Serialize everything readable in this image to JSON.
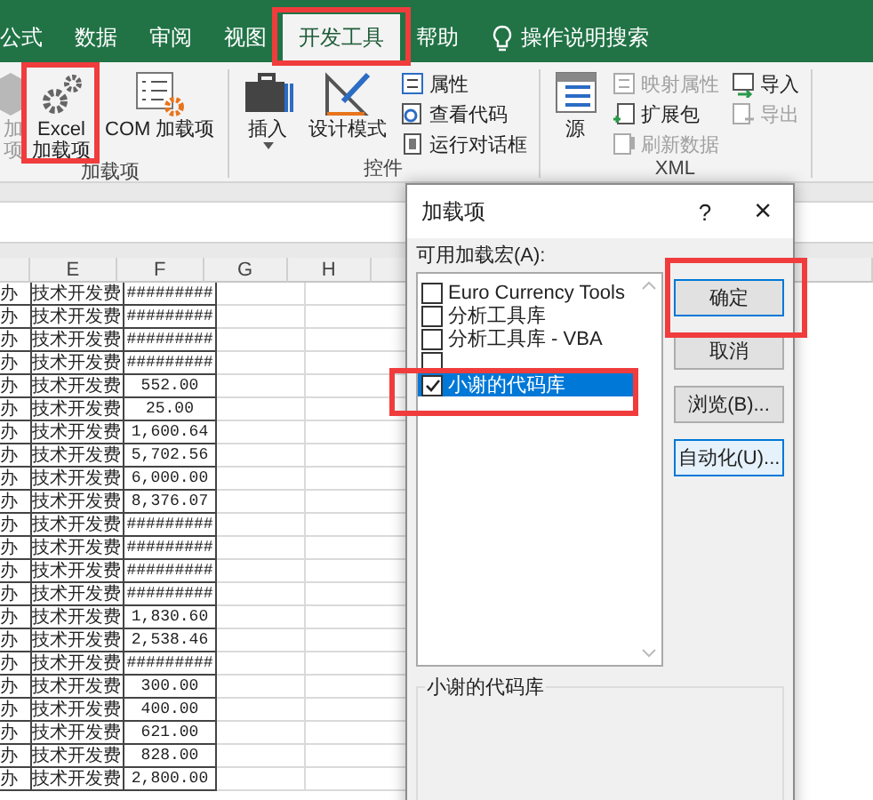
{
  "ribbon": {
    "tabs": [
      {
        "label": "公式",
        "selected": false,
        "highlighted": false
      },
      {
        "label": "数据",
        "selected": false,
        "highlighted": false
      },
      {
        "label": "审阅",
        "selected": false,
        "highlighted": false
      },
      {
        "label": "视图",
        "selected": false,
        "highlighted": false
      },
      {
        "label": "开发工具",
        "selected": true,
        "highlighted": true
      },
      {
        "label": "帮助",
        "selected": false,
        "highlighted": false
      }
    ],
    "search_hint": "操作说明搜索",
    "groups": [
      {
        "label": "加载项",
        "items": [
          {
            "kind": "large",
            "lines": [
              "加",
              "项"
            ],
            "disabled": true,
            "dropdown": false,
            "highlighted": false
          },
          {
            "kind": "large",
            "lines": [
              "Excel",
              "加载项"
            ],
            "disabled": false,
            "dropdown": false,
            "highlighted": true
          },
          {
            "kind": "large",
            "lines": [
              "COM 加载项"
            ],
            "disabled": false,
            "dropdown": false,
            "highlighted": false
          }
        ]
      },
      {
        "label": "控件",
        "items": [
          {
            "kind": "large",
            "lines": [
              "插入"
            ],
            "disabled": false,
            "dropdown": true,
            "highlighted": false
          },
          {
            "kind": "large",
            "lines": [
              "设计模式"
            ],
            "disabled": false,
            "dropdown": false,
            "highlighted": false
          },
          {
            "kind": "stack",
            "entries": [
              {
                "label": "属性",
                "disabled": false
              },
              {
                "label": "查看代码",
                "disabled": false
              },
              {
                "label": "运行对话框",
                "disabled": false
              }
            ]
          }
        ]
      },
      {
        "label": "XML",
        "items": [
          {
            "kind": "large",
            "lines": [
              "源"
            ],
            "disabled": false,
            "dropdown": false,
            "highlighted": false
          },
          {
            "kind": "stack",
            "entries": [
              {
                "label": "映射属性",
                "disabled": true
              },
              {
                "label": "扩展包",
                "disabled": false
              },
              {
                "label": "刷新数据",
                "disabled": true
              }
            ]
          },
          {
            "kind": "stack",
            "entries": [
              {
                "label": "导入",
                "disabled": false
              },
              {
                "label": "导出",
                "disabled": true
              }
            ]
          }
        ]
      }
    ]
  },
  "sheet": {
    "column_headers": [
      "E",
      "F",
      "G",
      "H"
    ],
    "rows": [
      {
        "d": "办",
        "e": "技术开发费",
        "f": "#########"
      },
      {
        "d": "办",
        "e": "技术开发费",
        "f": "#########"
      },
      {
        "d": "办",
        "e": "技术开发费",
        "f": "#########"
      },
      {
        "d": "办",
        "e": "技术开发费",
        "f": "#########"
      },
      {
        "d": "办",
        "e": "技术开发费",
        "f": "552.00"
      },
      {
        "d": "办",
        "e": "技术开发费",
        "f": "25.00"
      },
      {
        "d": "办",
        "e": "技术开发费",
        "f": "1,600.64"
      },
      {
        "d": "办",
        "e": "技术开发费",
        "f": "5,702.56"
      },
      {
        "d": "办",
        "e": "技术开发费",
        "f": "6,000.00"
      },
      {
        "d": "办",
        "e": "技术开发费",
        "f": "8,376.07"
      },
      {
        "d": "办",
        "e": "技术开发费",
        "f": "#########"
      },
      {
        "d": "办",
        "e": "技术开发费",
        "f": "#########"
      },
      {
        "d": "办",
        "e": "技术开发费",
        "f": "#########"
      },
      {
        "d": "办",
        "e": "技术开发费",
        "f": "#########"
      },
      {
        "d": "办",
        "e": "技术开发费",
        "f": "1,830.60"
      },
      {
        "d": "办",
        "e": "技术开发费",
        "f": "2,538.46"
      },
      {
        "d": "办",
        "e": "技术开发费",
        "f": "#########"
      },
      {
        "d": "办",
        "e": "技术开发费",
        "f": "300.00"
      },
      {
        "d": "办",
        "e": "技术开发费",
        "f": "400.00"
      },
      {
        "d": "办",
        "e": "技术开发费",
        "f": "621.00"
      },
      {
        "d": "办",
        "e": "技术开发费",
        "f": "828.00"
      },
      {
        "d": "办",
        "e": "技术开发费",
        "f": "2,800.00"
      }
    ]
  },
  "dialog": {
    "title": "加载项",
    "help": "?",
    "close": "×",
    "list_label": "可用加载宏(A):",
    "items": [
      {
        "label": "Euro Currency Tools",
        "checked": false,
        "selected": false,
        "highlighted": false
      },
      {
        "label": "分析工具库",
        "checked": false,
        "selected": false,
        "highlighted": false
      },
      {
        "label": "分析工具库 - VBA",
        "checked": false,
        "selected": false,
        "highlighted": false
      },
      {
        "checked": false,
        "selected": false,
        "highlighted": false
      },
      {
        "label": "小谢的代码库",
        "checked": true,
        "selected": true,
        "highlighted": true
      }
    ],
    "buttons": [
      {
        "label": "确定",
        "default": true,
        "hovered": false,
        "highlighted": true
      },
      {
        "label": "取消",
        "default": false,
        "hovered": false,
        "highlighted": false
      },
      {
        "label": "浏览(B)...",
        "default": false,
        "hovered": false,
        "highlighted": false
      },
      {
        "label": "自动化(U)...",
        "default": false,
        "hovered": true,
        "highlighted": false
      }
    ],
    "description_title": "小谢的代码库"
  }
}
